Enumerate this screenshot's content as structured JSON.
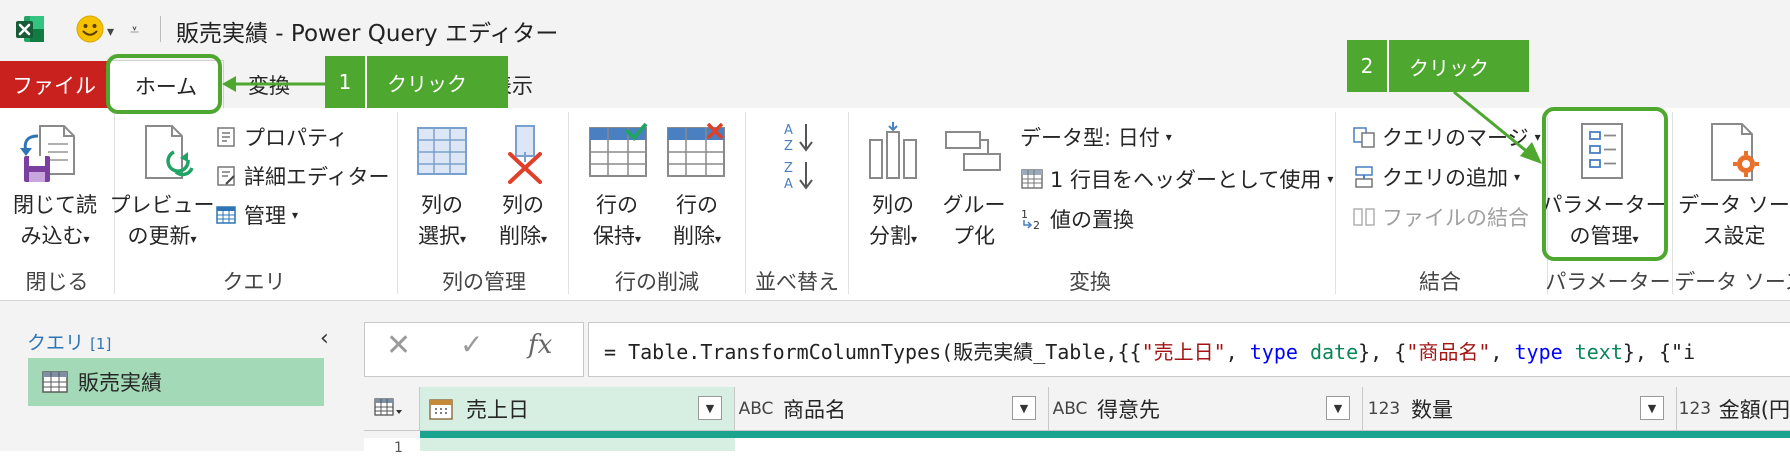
{
  "window": {
    "title": "販売実績 - Power Query エディター",
    "app_icon": "excel-icon",
    "qat_icon": "smiley-feedback-icon"
  },
  "tabs": {
    "file": "ファイル",
    "home": "ホーム",
    "transform": "変換",
    "view": "表示"
  },
  "ribbon": {
    "close": {
      "close_load_line1": "閉じて読",
      "close_load_line2": "み込む",
      "label": "閉じる"
    },
    "query": {
      "refresh_line1": "プレビュー",
      "refresh_line2": "の更新",
      "properties": "プロパティ",
      "advanced_editor": "詳細エディター",
      "manage": "管理",
      "label": "クエリ"
    },
    "columns": {
      "choose_line1": "列の",
      "choose_line2": "選択",
      "remove_line1": "列の",
      "remove_line2": "削除",
      "label": "列の管理"
    },
    "rows": {
      "keep_line1": "行の",
      "keep_line2": "保持",
      "remove_line1": "行の",
      "remove_line2": "削除",
      "label": "行の削減"
    },
    "sort": {
      "label": "並べ替え"
    },
    "transform": {
      "split_line1": "列の",
      "split_line2": "分割",
      "group_line1": "グルー",
      "group_line2": "プ化",
      "datatype": "データ型: 日付",
      "use_header": "1 行目をヘッダーとして使用",
      "replace": "値の置換",
      "label": "変換"
    },
    "combine": {
      "merge": "クエリのマージ",
      "append": "クエリの追加",
      "combine_files": "ファイルの結合",
      "label": "結合"
    },
    "params": {
      "manage_line1": "パラメーター",
      "manage_line2": "の管理",
      "label": "パラメーター"
    },
    "datasource": {
      "settings_line1": "データ ソー",
      "settings_line2": "ス設定",
      "label": "データ ソース"
    }
  },
  "callouts": {
    "c1_num": "1",
    "c1_text": "クリック",
    "c2_num": "2",
    "c2_text": "クリック",
    "color": "#4ea72e"
  },
  "queries": {
    "title": "クエリ",
    "count": "[1]",
    "items": [
      {
        "name": "販売実績"
      }
    ]
  },
  "formula": {
    "prefix": "= Table.TransformColumnTypes(販売実績_Table,{{",
    "s1": "\"売上日\"",
    "sep1": ", ",
    "k1": "type",
    "t1": " date",
    "sep2": "}, {",
    "s2": "\"商品名\"",
    "sep3": ", ",
    "k2": "type",
    "t2": " text",
    "sep4": "}, {\"i"
  },
  "grid": {
    "columns": [
      {
        "type": "",
        "name": "売上日"
      },
      {
        "type": "ABC",
        "name": "商品名"
      },
      {
        "type": "ABC",
        "name": "得意先"
      },
      {
        "type": "123",
        "name": "数量"
      },
      {
        "type": "123",
        "name": "金額(円"
      }
    ],
    "row_number": "1"
  }
}
